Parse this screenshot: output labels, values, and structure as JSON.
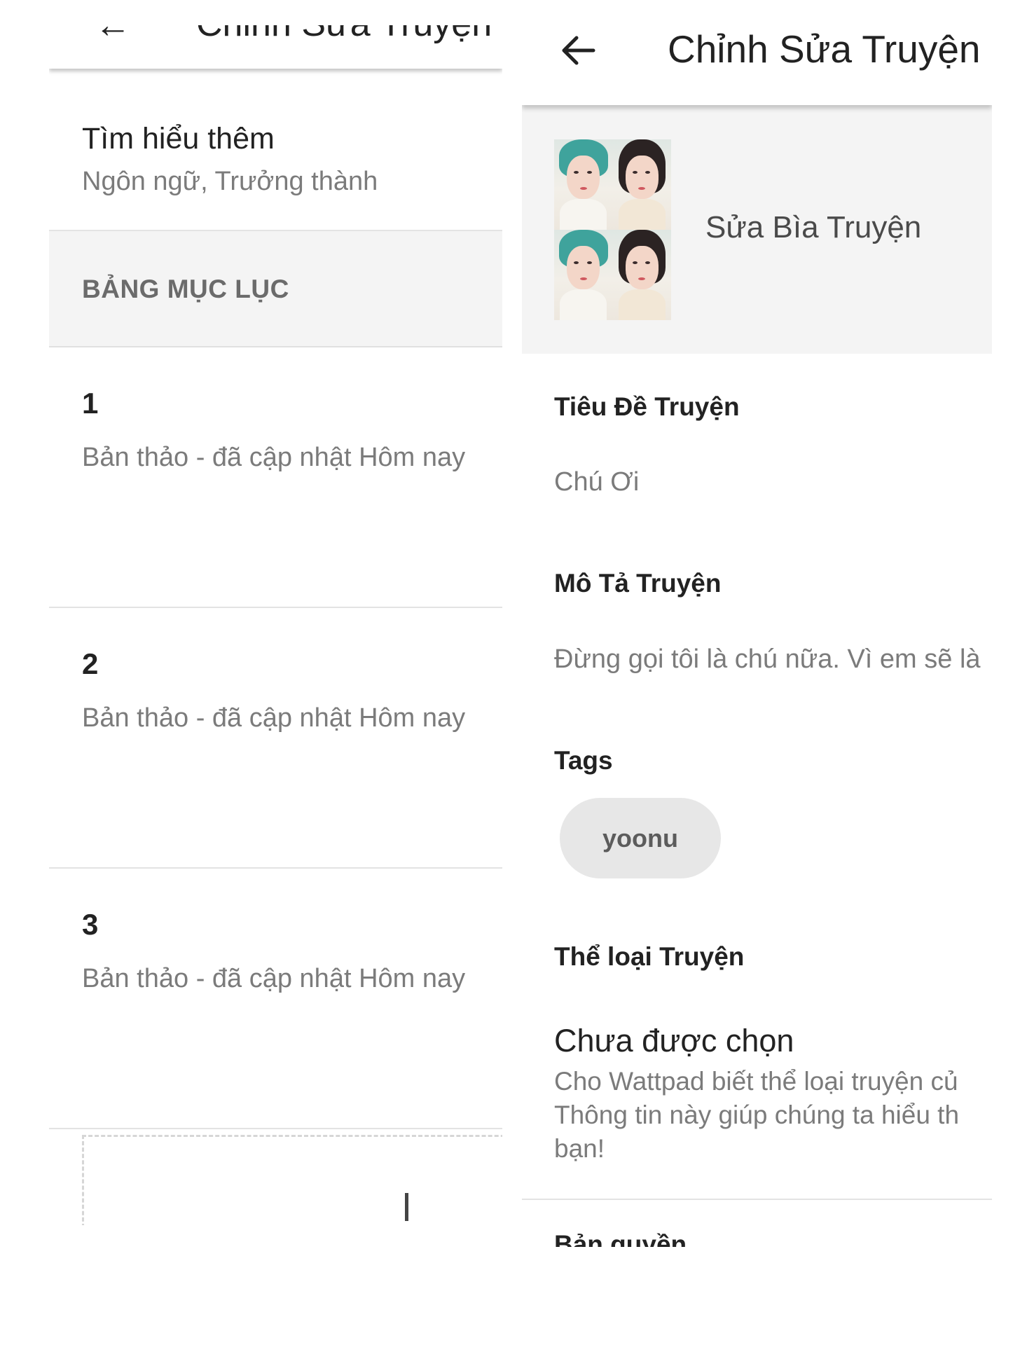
{
  "left": {
    "topbar_title": "Chỉnh Sửa Truyện",
    "learn_more": {
      "title": "Tìm hiểu thêm",
      "subtitle": "Ngôn ngữ, Trưởng thành"
    },
    "toc_header": "BẢNG MỤC LỤC",
    "chapters": [
      {
        "number": "1",
        "status": "Bản thảo - đã cập nhật Hôm nay"
      },
      {
        "number": "2",
        "status": "Bản thảo - đã cập nhật Hôm nay"
      },
      {
        "number": "3",
        "status": "Bản thảo - đã cập nhật Hôm nay"
      }
    ]
  },
  "right": {
    "title": "Chỉnh Sửa Truyện",
    "edit_cover_label": "Sửa Bìa Truyện",
    "story_title_label": "Tiêu Đề Truyện",
    "story_title_value": "Chú Ơi",
    "description_label": "Mô Tả Truyện",
    "description_value": "Đừng gọi tôi là chú nữa. Vì em sẽ là",
    "tags_label": "Tags",
    "tags": [
      "yoonu"
    ],
    "genre_label": "Thể loại Truyện",
    "genre_value": "Chưa được chọn",
    "genre_help": "Cho Wattpad biết thể loại truyện củ\nThông tin này giúp chúng ta hiểu th\nbạn!",
    "copyright_label": "Bản quyền"
  },
  "colors": {
    "section_bg": "#f4f4f4",
    "chip_bg": "#e7e7e7",
    "secondary_text": "#7b7b7b"
  }
}
